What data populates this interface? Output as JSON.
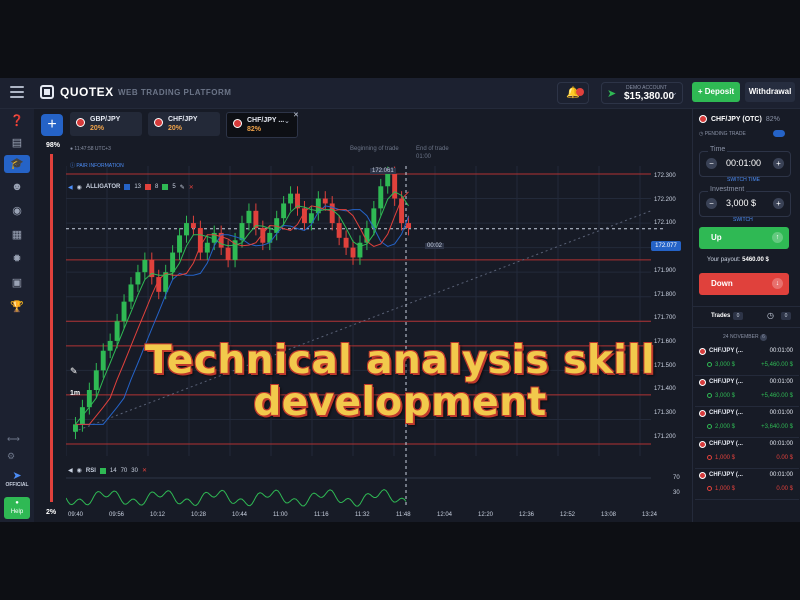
{
  "header": {
    "logo": "QUOTEX",
    "platform": "WEB TRADING PLATFORM",
    "notification_count": "",
    "account_label": "DEMO ACCOUNT",
    "balance": "$15,380.00",
    "deposit_label": "Deposit",
    "withdraw_label": "Withdrawal"
  },
  "assets": [
    {
      "name": "GBP/JPY",
      "payout": "20%"
    },
    {
      "name": "CHF/JPY",
      "payout": "20%"
    },
    {
      "name": "CHF/JPY ...",
      "payout": "82%"
    }
  ],
  "left_scale": {
    "top": "98%",
    "bottom": "2%"
  },
  "left_sidebar": {
    "official": "OFFICIAL",
    "help": "Help"
  },
  "chart": {
    "clock": "11:47:58",
    "tz": "UTC+3",
    "pair_info": "PAIR INFORMATION",
    "indicator": "ALLIGATOR",
    "indicator_params": [
      "13",
      "8",
      "5"
    ],
    "timeframe": "1m",
    "beginning": "Beginning of trade",
    "end": "End of trade",
    "end_time": "01:00",
    "current_price": "172.077",
    "countdown": "00:02",
    "tooltip_price": "172.061",
    "rsi": "RSI",
    "rsi_params": [
      "14",
      "70",
      "30"
    ],
    "rsi_levels": [
      "70",
      "30"
    ]
  },
  "chart_data": {
    "type": "candlestick",
    "price_axis": [
      "172.300",
      "172.200",
      "172.100",
      "172.000",
      "171.900",
      "171.800",
      "171.700",
      "171.600",
      "171.500",
      "171.400",
      "171.300",
      "171.200"
    ],
    "time_axis": [
      "09:40",
      "09:56",
      "10:12",
      "10:28",
      "10:44",
      "11:00",
      "11:16",
      "11:32",
      "11:48",
      "12:04",
      "12:20",
      "12:36",
      "12:52",
      "13:08",
      "13:24"
    ],
    "current_price": 172.077,
    "close": [
      171.28,
      171.35,
      171.42,
      171.5,
      171.58,
      171.62,
      171.7,
      171.78,
      171.85,
      171.9,
      171.95,
      171.88,
      171.82,
      171.9,
      171.98,
      172.05,
      172.1,
      172.08,
      171.98,
      172.02,
      172.06,
      172.0,
      171.95,
      172.03,
      172.1,
      172.15,
      172.08,
      172.02,
      172.06,
      172.12,
      172.18,
      172.22,
      172.16,
      172.1,
      172.14,
      172.2,
      172.18,
      172.1,
      172.04,
      172.0,
      171.96,
      172.02,
      172.08,
      172.16,
      172.25,
      172.3,
      172.2,
      172.1,
      172.08
    ]
  },
  "panel": {
    "pair": "CHF/JPY (OTC)",
    "payout_pct": "82%",
    "pending": "PENDING TRADE",
    "time_label": "Time",
    "time_value": "00:01:00",
    "switch_time": "SWITCH TIME",
    "investment_label": "Investment",
    "investment_value": "3,000 $",
    "switch": "SWITCH",
    "up": "Up",
    "payout_label": "Your payout:",
    "payout_value": "5460.00 $",
    "down": "Down"
  },
  "trades": {
    "label": "Trades",
    "count": "0",
    "count2": "0",
    "date": "24 NOVEMBER",
    "date_count": "6",
    "items": [
      {
        "name": "CHF/JPY (...",
        "time": "00:01:00",
        "amount": "3,000 $",
        "result": "+5,460.00 $"
      },
      {
        "name": "CHF/JPY (...",
        "time": "00:01:00",
        "amount": "3,000 $",
        "result": "+5,460.00 $"
      },
      {
        "name": "CHF/JPY (...",
        "time": "00:01:00",
        "amount": "2,000 $",
        "result": "+3,640.00 $"
      },
      {
        "name": "CHF/JPY (...",
        "time": "00:01:00",
        "amount": "1,000 $",
        "result": "0.00 $"
      },
      {
        "name": "CHF/JPY (...",
        "time": "00:01:00",
        "amount": "1,000 $",
        "result": "0.00 $"
      }
    ]
  },
  "overlay": {
    "line1": "Technical analysis skill",
    "line2": "development"
  },
  "colors": {
    "up": "#2fb954",
    "down": "#e0413c",
    "accent": "#2563c7",
    "overlay_text": "#f2c94c"
  }
}
